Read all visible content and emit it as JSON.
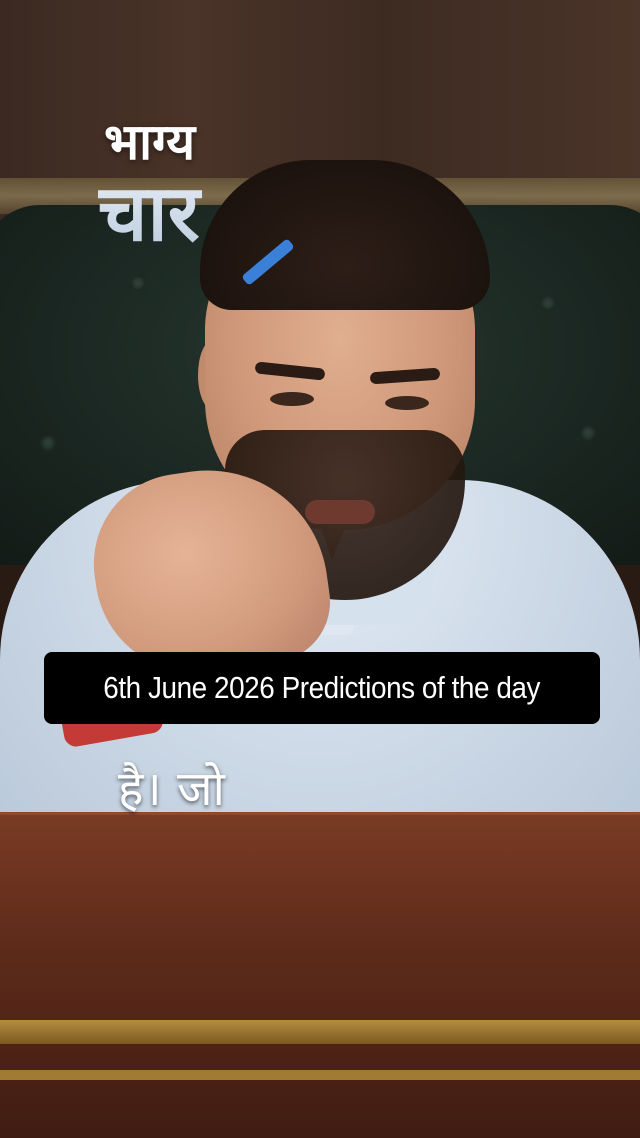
{
  "logo": {
    "line1": "भाग्य",
    "line2": "चार"
  },
  "caption": {
    "text": "6th June 2026 Predictions of the day"
  },
  "subtitle": {
    "text": "है। जो"
  },
  "colors": {
    "caption_bg": "#000000",
    "caption_text": "#ffffff",
    "logo_accent": "#3a7fd8"
  }
}
